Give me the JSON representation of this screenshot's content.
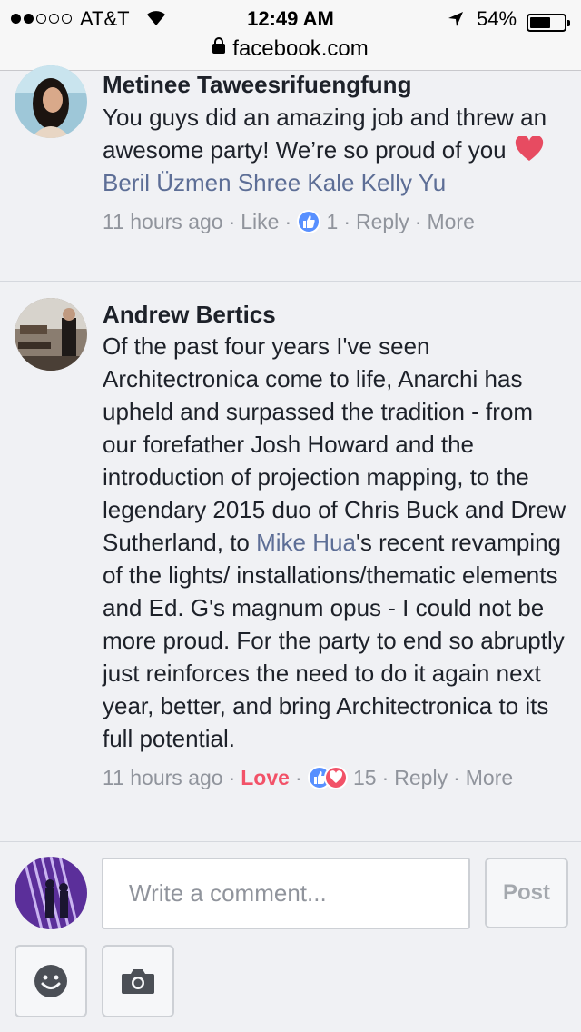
{
  "status_bar": {
    "carrier": "AT&T",
    "time": "12:49 AM",
    "battery_percent": "54%",
    "battery_level": 0.54,
    "signal_bars_filled": 2,
    "signal_bars_total": 5
  },
  "url_bar": {
    "domain": "facebook.com"
  },
  "comments": [
    {
      "author": "Metinee Taweesrifuengfung",
      "text_before": "You guys did an amazing job and threw an awesome party! We’re so proud of you",
      "heart_emoji": "heart-emoji",
      "mentions": "Beril Üzmen Shree Kale Kelly Yu",
      "time": "11 hours ago",
      "action_like": "Like",
      "reaction_count": "1",
      "action_reply": "Reply",
      "action_more": "More"
    },
    {
      "author": "Andrew Bertics",
      "text_before": "Of the past four years I've seen Architectronica come to life, Anarchi has upheld and surpassed the tradition - from our forefather Josh Howard and the introduction of projection mapping, to the legendary 2015 duo of Chris Buck and Drew Sutherland, to ",
      "mention": "Mike Hua",
      "text_after": "'s recent revamping of the lights/ installations/thematic elements and Ed. G's magnum opus - I could not be more proud. For the party to end so abruptly just reinforces the need to do it again next year, better, and bring Architectronica to its full potential.",
      "time": "11 hours ago",
      "action_love": "Love",
      "reaction_count": "15",
      "action_reply": "Reply",
      "action_more": "More"
    }
  ],
  "composer": {
    "placeholder": "Write a comment...",
    "post_label": "Post"
  },
  "colors": {
    "link": "#5d6e96",
    "love": "#f25268",
    "like": "#5890ff",
    "meta": "#90949c"
  }
}
